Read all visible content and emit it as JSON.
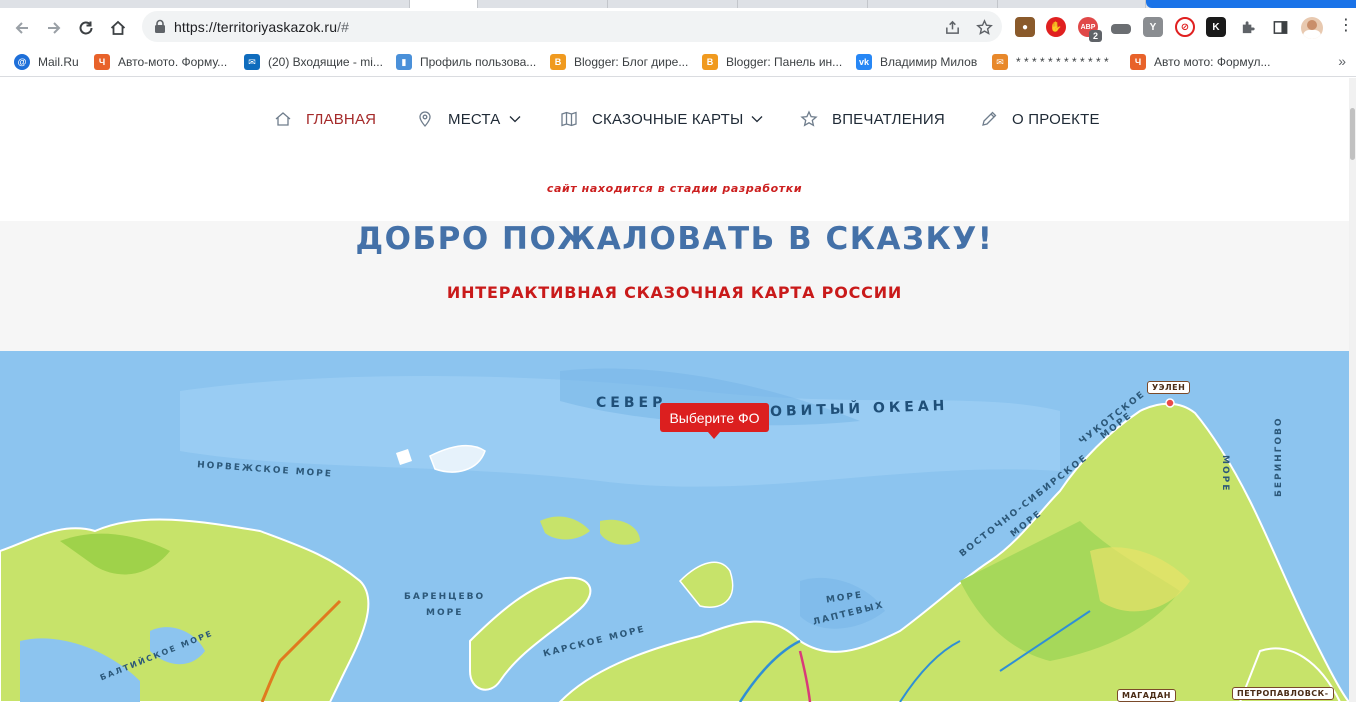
{
  "browser": {
    "url_host": "https://territoriyaskazok.ru",
    "url_rest": "/#",
    "extension_badge": "2"
  },
  "bookmarks": [
    {
      "label": "Mail.Ru",
      "icon": "mailru-icon",
      "color": "#1e6fd9"
    },
    {
      "label": "Авто-мото. Форму...",
      "icon": "forum-icon",
      "color": "#e8622a"
    },
    {
      "label": "(20) Входящие - mi...",
      "icon": "outlook-icon",
      "color": "#0f6cbd"
    },
    {
      "label": "Профиль пользова...",
      "icon": "profile-icon",
      "color": "#4a90d9"
    },
    {
      "label": "Blogger: Блог дире...",
      "icon": "blogger-icon",
      "color": "#f09a1f"
    },
    {
      "label": "Blogger: Панель ин...",
      "icon": "blogger-icon",
      "color": "#f09a1f"
    },
    {
      "label": "Владимир Милов",
      "icon": "vk-icon",
      "color": "#2787f5"
    },
    {
      "label": "* * * * * * * * * * * *",
      "icon": "mail-icon",
      "color": "#e8882a"
    },
    {
      "label": "Авто мото: Формул...",
      "icon": "forum-icon",
      "color": "#e8622a"
    }
  ],
  "nav": {
    "home": "ГЛАВНАЯ",
    "places": "МЕСТА",
    "maps": "СКАЗОЧНЫЕ КАРТЫ",
    "impressions": "ВПЕЧАТЛЕНИЯ",
    "about": "О ПРОЕКТЕ"
  },
  "dev_note": "сайт находится в стадии разработки",
  "hero": {
    "title": "ДОБРО ПОЖАЛОВАТЬ В СКАЗКУ!",
    "subtitle": "ИНТЕРАКТИВНАЯ СКАЗОЧНАЯ КАРТА РОССИИ"
  },
  "map": {
    "tooltip": "Выберите ФО",
    "ocean_left": "СЕВЕР",
    "ocean_right": "ОВИТЫЙ ОКЕАН",
    "seas": {
      "norwegian": "НОРВЕЖСКОЕ МОРЕ",
      "barents_1": "БАРЕНЦЕВО",
      "barents_2": "МОРЕ",
      "kara": "КАРСКОЕ МОРЕ",
      "laptev_1": "МОРЕ",
      "laptev_2": "ЛАПТЕВЫХ",
      "east_siberian_1": "ВОСТОЧНО-СИБИРСКОЕ",
      "east_siberian_2": "МОРЕ",
      "chukchi_1": "ЧУКОТСКОЕ",
      "chukchi_2": "МОРЕ",
      "bering_1": "МОРЕ",
      "bering_2": "БЕРИНГОВО",
      "baltic": "БАЛТИЙСКОЕ МОРЕ"
    },
    "cities": {
      "uelen": "УЭЛЕН",
      "magadan": "МАГАДАН",
      "petropavlovsk": "ПЕТРОПАВЛОВСК-"
    }
  },
  "colors": {
    "nav_active": "#a52a2a",
    "hero_title": "#4471a8",
    "hero_subtitle": "#c91a1a",
    "tooltip_bg": "#dc1f1f",
    "sea": "#8cc4ef",
    "land": "#c7e36a"
  }
}
